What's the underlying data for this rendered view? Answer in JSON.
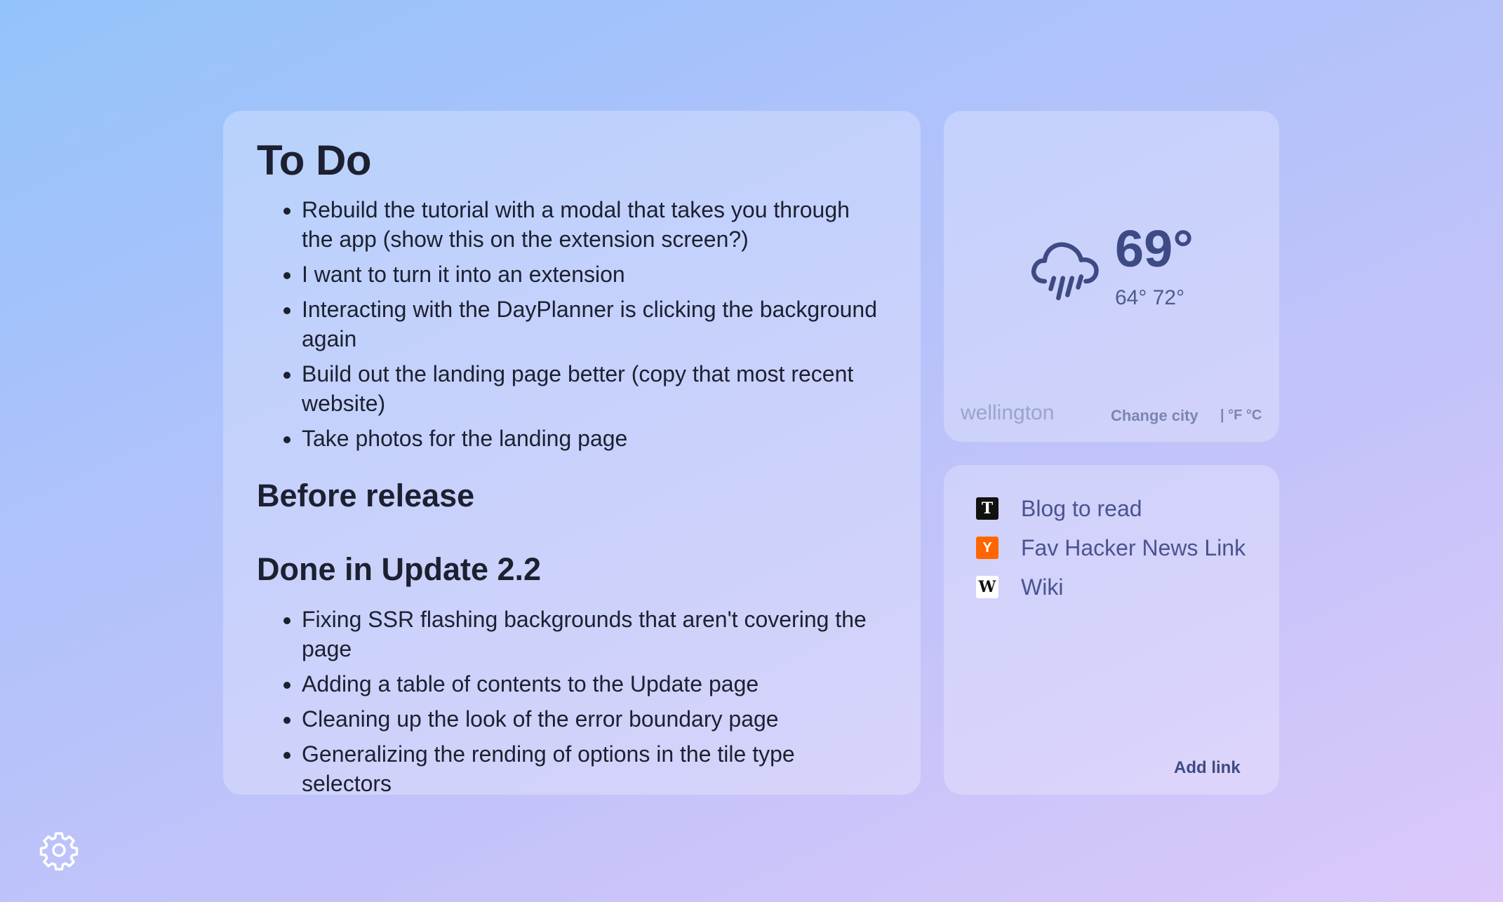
{
  "todo": {
    "title": "To Do",
    "items": [
      "Rebuild the tutorial with a modal that takes you through the app (show this on the extension screen?)",
      "I want to turn it into an extension",
      "Interacting with the DayPlanner is clicking the background again",
      "Build out the landing page better (copy that most recent website)",
      "Take photos for the landing page"
    ]
  },
  "before_release": {
    "title": "Before release"
  },
  "done_update": {
    "title": "Done in Update 2.2",
    "items": [
      "Fixing SSR flashing backgrounds that aren't covering the page",
      "Adding a table of contents to the Update page",
      "Cleaning up the look of the error boundary page",
      "Generalizing the rending of options in the tile type selectors"
    ]
  },
  "weather": {
    "icon": "rain-cloud-icon",
    "temperature": "69°",
    "range": "64° 72°",
    "city": "wellington",
    "change_city_label": "Change city",
    "units_label": "| °F °C",
    "color": "#3e4a83"
  },
  "links": {
    "items": [
      {
        "label": "Blog to read",
        "favicon": "T",
        "icon": "t-favicon-icon"
      },
      {
        "label": "Fav Hacker News Link",
        "favicon": "Y",
        "icon": "hacker-news-favicon-icon"
      },
      {
        "label": "Wiki",
        "favicon": "W",
        "icon": "wikipedia-favicon-icon"
      }
    ],
    "add_label": "Add link"
  },
  "settings": {
    "icon": "gear-icon"
  }
}
